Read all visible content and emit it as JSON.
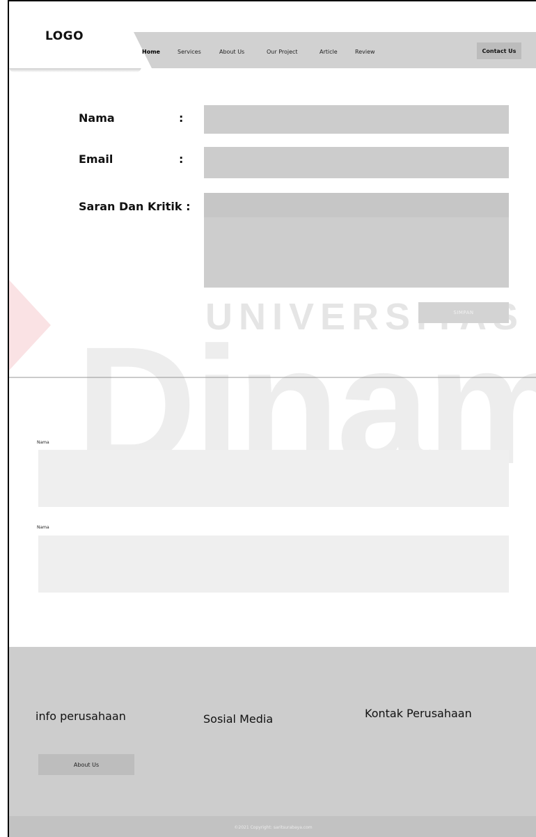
{
  "header": {
    "logo": "LOGO",
    "nav": [
      "Home",
      "Services",
      "About Us",
      "Our Project",
      "Article",
      "Review"
    ],
    "contact_label": "Contact Us"
  },
  "form": {
    "name_label": "Nama",
    "email_label": "Email",
    "message_label": "Saran Dan Kritik :",
    "colon": ":",
    "save_label": "SIMPAN"
  },
  "reviews": [
    {
      "label": "Nama"
    },
    {
      "label": "Nama"
    }
  ],
  "footer": {
    "info_heading": "info perusahaan",
    "social_heading": "Sosial Media",
    "contact_heading": "Kontak Perusahaan",
    "about_label": "About Us",
    "copyright": "©2021 Copyright: saritsurabaya.com"
  },
  "watermark": {
    "top": "UNIVERSITAS",
    "bottom": "Dinami"
  },
  "colors": {
    "navbar": "#d1d1d1",
    "field": "#cccccc",
    "footer": "#cdcdcd"
  }
}
